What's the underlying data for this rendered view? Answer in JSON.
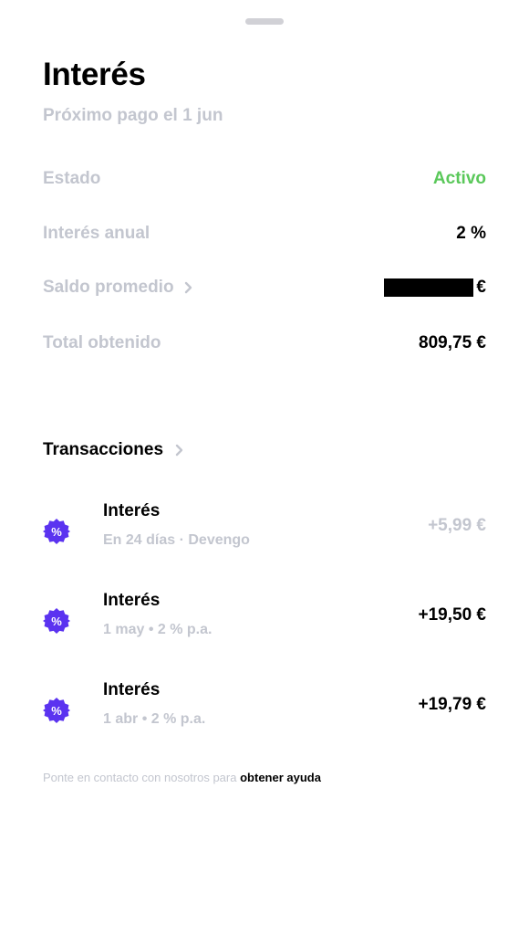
{
  "header": {
    "title": "Interés",
    "subtitle": "Próximo pago el 1 jun"
  },
  "details": {
    "estado": {
      "label": "Estado",
      "value": "Activo",
      "color": "#5ac85a"
    },
    "interes_anual": {
      "label": "Interés anual",
      "value": "2 %"
    },
    "saldo_promedio": {
      "label": "Saldo promedio",
      "value": "€",
      "value_redacted": true
    },
    "total_obtenido": {
      "label": "Total obtenido",
      "value": "809,75 €"
    }
  },
  "transactions": {
    "heading": "Transacciones",
    "items": [
      {
        "title": "Interés",
        "subtitle": "En 24 días · Devengo",
        "amount": "+5,99 €",
        "pending": true,
        "icon": "percent-badge-icon"
      },
      {
        "title": "Interés",
        "subtitle": "1 may • 2 % p.a.",
        "amount": "+19,50 €",
        "pending": false,
        "icon": "percent-badge-icon"
      },
      {
        "title": "Interés",
        "subtitle": "1 abr • 2 % p.a.",
        "amount": "+19,79 €",
        "pending": false,
        "icon": "percent-badge-icon"
      }
    ]
  },
  "footer": {
    "text": "Ponte en contacto con nosotros para",
    "link": "obtener ayuda"
  },
  "colors": {
    "accent": "#5b33f0",
    "muted": "#c3c6cf",
    "active": "#5ac85a"
  }
}
